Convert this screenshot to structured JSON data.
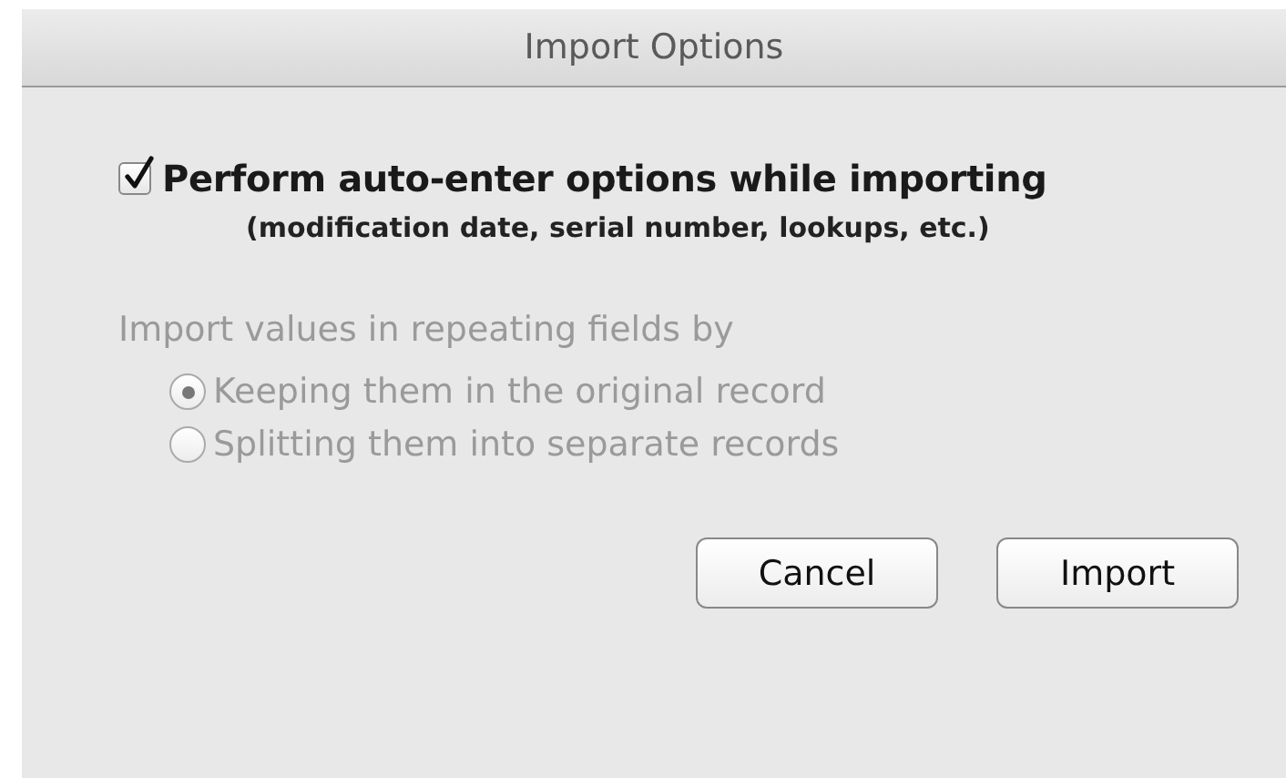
{
  "window": {
    "title": "Import Options"
  },
  "auto_enter": {
    "label": "Perform auto-enter options while importing",
    "note": "(modification date, serial number, lookups, etc.)",
    "checked": true
  },
  "repeating": {
    "label": "Import values in repeating fields by",
    "disabled": true,
    "options": [
      {
        "label": "Keeping them in the original record",
        "selected": true
      },
      {
        "label": "Splitting them into separate records",
        "selected": false
      }
    ]
  },
  "buttons": [
    {
      "label": "Cancel"
    },
    {
      "label": "Import"
    }
  ]
}
